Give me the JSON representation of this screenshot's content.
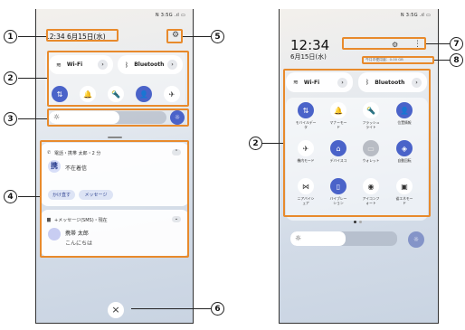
{
  "status_bar": {
    "text": "N 3:5G .ıl ▭"
  },
  "left": {
    "clock": "12:34  6月15日(水)",
    "settings_icon": "⚙",
    "wifi": {
      "label": "Wi-Fi",
      "chevron": "›"
    },
    "bluetooth": {
      "label": "Bluetooth",
      "chevron": "›"
    },
    "toggles": [
      "⇅",
      "🔔",
      "🔦",
      "👤",
      "✈"
    ],
    "notifications": {
      "missed_call": {
        "header": "電話・携帯 太郎・2 分",
        "status": "不在着信",
        "avatar": "携",
        "actions": [
          "かけ直す",
          "メッセージ"
        ]
      },
      "sms": {
        "header": "+メッセージ(SMS)・現在",
        "sender": "携帯 太郎",
        "body": "こんにちは"
      }
    },
    "close_icon": "×"
  },
  "right": {
    "clock": "12:34",
    "date": "6月15日(水)",
    "usage": "今月の使用量：0.00 GB",
    "settings_icon": "⚙",
    "more_icon": "⋮",
    "wifi": {
      "label": "Wi-Fi",
      "chevron": "›"
    },
    "bluetooth": {
      "label": "Bluetooth",
      "chevron": "›"
    },
    "tiles": [
      {
        "icon": "⇅",
        "label": "モバイルデー\nタ",
        "state": "on"
      },
      {
        "icon": "🔔",
        "label": "マナーモー\nド",
        "state": "off"
      },
      {
        "icon": "🔦",
        "label": "フラッシュ\nライト",
        "state": "off"
      },
      {
        "icon": "👤",
        "label": "位置情報",
        "state": "on"
      },
      {
        "icon": "✈",
        "label": "機内モード",
        "state": "off"
      },
      {
        "icon": "⌂",
        "label": "デバイスコ",
        "state": "on"
      },
      {
        "icon": "▭",
        "label": "ウォレット",
        "state": "dis"
      },
      {
        "icon": "◈",
        "label": "自動回転",
        "state": "on"
      },
      {
        "icon": "⋈",
        "label": "ニアバイシ\nェア",
        "state": "off"
      },
      {
        "icon": "▯",
        "label": "バイブレー\nション",
        "state": "on"
      },
      {
        "icon": "◉",
        "label": "アイコンフ\nォート",
        "state": "off"
      },
      {
        "icon": "▣",
        "label": "省エネモー\nド",
        "state": "off"
      }
    ]
  },
  "callouts": [
    "1",
    "2",
    "3",
    "4",
    "5",
    "6",
    "2",
    "7",
    "8"
  ]
}
